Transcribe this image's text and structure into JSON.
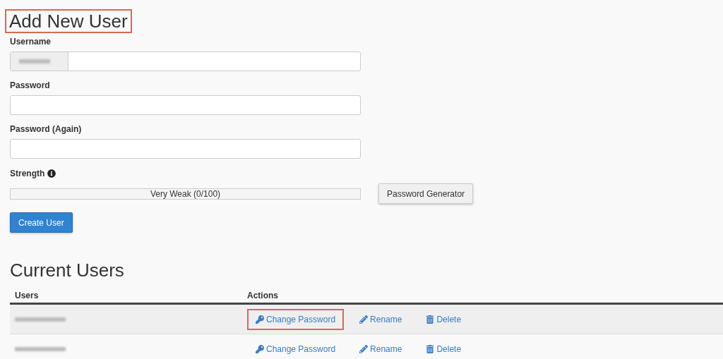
{
  "form": {
    "title": "Add New User",
    "title_highlighted": true,
    "fields": [
      {
        "label": "Username",
        "kind": "prefixed"
      },
      {
        "label": "Password",
        "kind": "plain"
      },
      {
        "label": "Password (Again)",
        "kind": "plain"
      }
    ],
    "strength": {
      "label": "Strength",
      "reading": "Very Weak (0/100)"
    },
    "generator_button": "Password Generator",
    "submit_button": "Create User"
  },
  "users": {
    "title": "Current Users",
    "columns": [
      "Users",
      "Actions"
    ],
    "rows": [
      {
        "actions": [
          {
            "kind": "key",
            "label": "Change Password",
            "highlighted": true
          },
          {
            "kind": "pencil",
            "label": "Rename",
            "highlighted": false
          },
          {
            "kind": "trash",
            "label": "Delete",
            "highlighted": false
          }
        ]
      },
      {
        "actions": [
          {
            "kind": "key",
            "label": "Change Password",
            "highlighted": false
          },
          {
            "kind": "pencil",
            "label": "Rename",
            "highlighted": false
          },
          {
            "kind": "trash",
            "label": "Delete",
            "highlighted": false
          }
        ]
      }
    ]
  }
}
